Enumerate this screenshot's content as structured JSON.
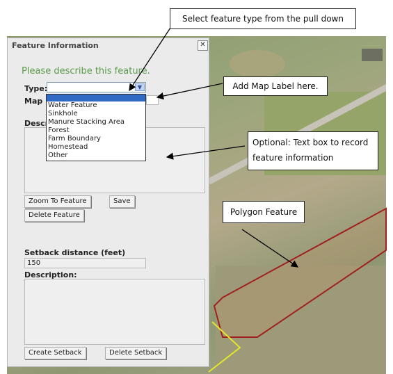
{
  "panel": {
    "title": "Feature Information",
    "close_glyph": "✕",
    "heading": "Please describe this feature.",
    "type_label": "Type:",
    "map_label_label": "Map L",
    "description_label": "Descr",
    "type_options": [
      "Water Feature",
      "Sinkhole",
      "Manure Stacking Area",
      "Forest",
      "Farm Boundary",
      "Homestead",
      "Other"
    ],
    "zoom_button": "Zoom To Feature",
    "save_button": "Save",
    "delete_button": "Delete Feature",
    "setback_label": "Setback distance (feet)",
    "setback_value": "150",
    "setback_description_label": "Description:",
    "create_setback_button": "Create Setback",
    "delete_setback_button": "Delete Setback"
  },
  "callouts": {
    "select_type": "Select feature type from the pull down",
    "add_label": "Add Map Label here.",
    "optional_text": "Optional: Text box to record feature information",
    "polygon": "Polygon Feature"
  },
  "colors": {
    "heading_green": "#5a9a4a",
    "polygon_outline": "#a02020",
    "selection_blue": "#316ac5"
  }
}
